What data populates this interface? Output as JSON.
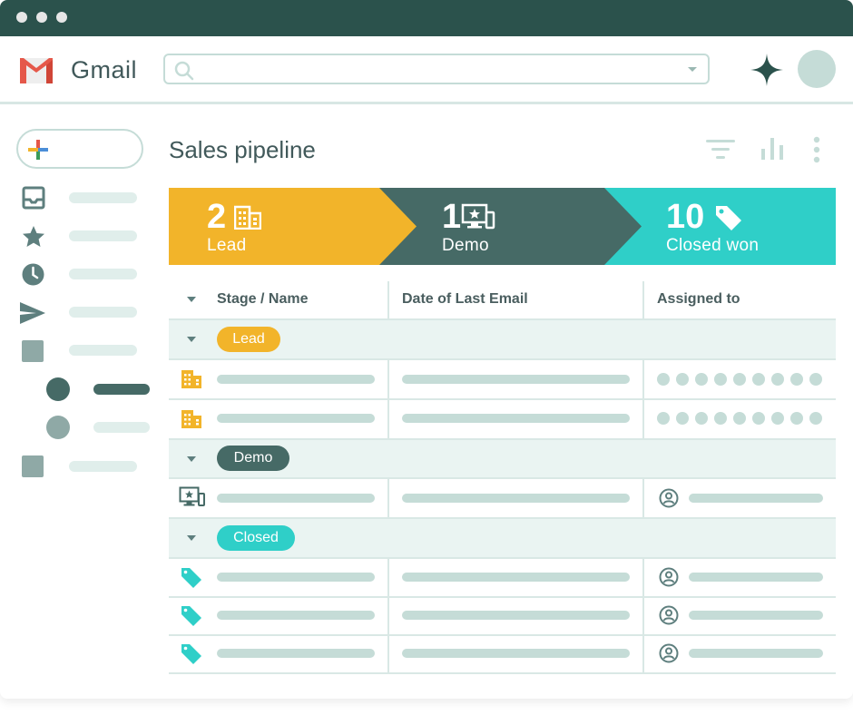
{
  "app": {
    "name": "Gmail"
  },
  "search": {
    "placeholder": ""
  },
  "page": {
    "title": "Sales pipeline"
  },
  "stages": [
    {
      "count": "2",
      "label": "Lead",
      "icon": "building-icon",
      "color": "#f2b42a"
    },
    {
      "count": "1",
      "label": "Demo",
      "icon": "demo-screen-icon",
      "color": "#466a66"
    },
    {
      "count": "10",
      "label": "Closed won",
      "icon": "tag-icon",
      "color": "#2fcfc8"
    }
  ],
  "table": {
    "columns": [
      "Stage / Name",
      "Date of Last Email",
      "Assigned to"
    ],
    "groups": [
      {
        "label": "Lead",
        "color": "#f2b42a",
        "text_color": "#ffffff",
        "rows": 2,
        "icon": "building-icon",
        "assignee": "dots"
      },
      {
        "label": "Demo",
        "color": "#466a66",
        "text_color": "#ffffff",
        "rows": 1,
        "icon": "demo-screen-icon",
        "assignee": "person"
      },
      {
        "label": "Closed",
        "color": "#2fcfc8",
        "text_color": "#ffffff",
        "rows": 3,
        "icon": "tag-icon",
        "assignee": "person"
      }
    ]
  },
  "colors": {
    "titlebar": "#2b524c",
    "accent_light": "#c5dcd7",
    "group_bg": "#eaf4f2"
  }
}
